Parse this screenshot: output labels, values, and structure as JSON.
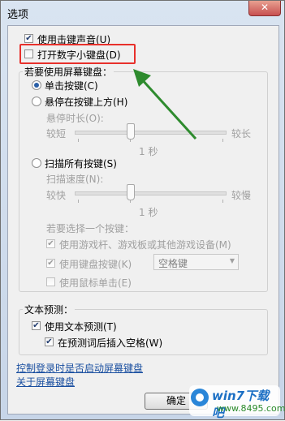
{
  "window": {
    "title": "选项",
    "close_glyph": "✕"
  },
  "options": {
    "click_sound": {
      "label": "使用击键声音(U)",
      "checked": true
    },
    "numpad": {
      "label": "打开数字小键盘(D)",
      "checked": false
    }
  },
  "screen_keyboard": {
    "group_title": "若要使用屏幕键盘：",
    "click_keys": {
      "label": "单击按键(C)",
      "selected": true
    },
    "hover": {
      "label": "悬停在按键上方(H)",
      "selected": false
    },
    "hover_duration": {
      "label": "悬停时长(O):",
      "min_label": "较短",
      "max_label": "较长",
      "value_text": "1 秒",
      "value_fraction": 0.2
    },
    "scan": {
      "label": "扫描所有按键(S)",
      "selected": false
    },
    "scan_speed": {
      "label": "扫描速度(N):",
      "min_label": "较快",
      "max_label": "较慢",
      "value_text": "1 秒",
      "value_fraction": 0.2
    },
    "select_key_label": "若要选择一个按键：",
    "joystick": {
      "label": "使用游戏杆、游戏板或其他游戏设备(M)",
      "checked": true
    },
    "keyboard_key": {
      "label": "使用键盘按键(K)",
      "checked": true
    },
    "key_combo": {
      "value": "空格键",
      "arrow": "▼"
    },
    "mouse_click": {
      "label": "使用鼠标单击(E)",
      "checked": false
    }
  },
  "text_prediction": {
    "group_title": "文本预测：",
    "use_prediction": {
      "label": "使用文本预测(T)",
      "checked": true
    },
    "insert_space": {
      "label": "在预测词后插入空格(W)",
      "checked": true
    }
  },
  "links": {
    "startup": "控制登录时是否启动屏幕键盘",
    "about": "关于屏幕键盘"
  },
  "buttons": {
    "ok": "确定"
  },
  "watermark": {
    "name": "win7下载吧",
    "url": "www.8495.com"
  },
  "colors": {
    "highlight": "#e8302b",
    "arrow": "#2e8b2e",
    "link": "#1a4fa0"
  },
  "icons": {
    "check": "✔"
  }
}
